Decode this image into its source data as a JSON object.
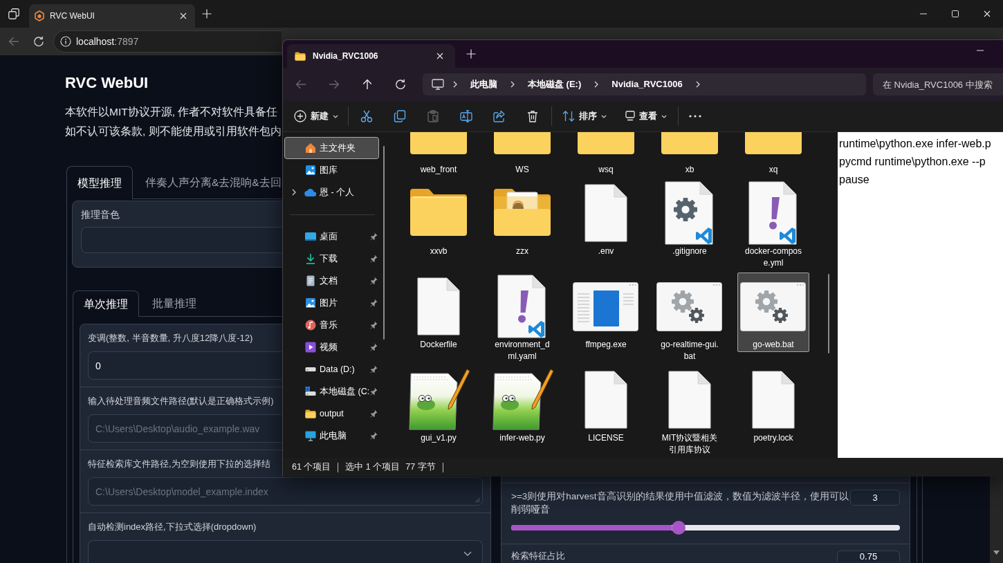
{
  "browser": {
    "tabs": [
      {
        "title": "RVC WebUI",
        "selected": true
      }
    ],
    "nav": [
      {
        "kind": "back",
        "disabled": true
      },
      {
        "kind": "reload",
        "disabled": false
      }
    ],
    "address": {
      "host": "localhost",
      "port": ":7897"
    }
  },
  "page": {
    "title": "RVC WebUI",
    "notice": [
      "本软件以MIT协议开源, 作者不对软件具备任",
      "如不认可该条款, 则不能使用或引用软件包内"
    ],
    "tabs": [
      {
        "label": "模型推理",
        "selected": true
      },
      {
        "label": "伴奏人声分离&去混响&去回",
        "selected": false
      }
    ],
    "voice": {
      "label": "推理音色"
    },
    "subtabs": [
      {
        "label": "单次推理",
        "selected": true
      },
      {
        "label": "批量推理",
        "selected": false
      }
    ],
    "left_fields": [
      {
        "kind": "textbox",
        "label": "变调(整数, 半音数量, 升八度12降八度-12)",
        "value": "0"
      },
      {
        "kind": "textbox",
        "label": "输入待处理音频文件路径(默认是正确格式示例)",
        "placeholder": "C:\\Users\\Desktop\\audio_example.wav"
      },
      {
        "kind": "textarea",
        "label": "特征检索库文件路径,为空则使用下拉的选择结",
        "placeholder": "C:\\Users\\Desktop\\model_example.index"
      },
      {
        "kind": "dropdown",
        "label": "自动检测index路径,下拉式选择(dropdown)"
      }
    ],
    "right_fields": [
      {
        "kind": "slider",
        "label": ">=3则使用对harvest音高识别的结果使用中值滤波，数值为滤波半径，使用可以削弱哑音",
        "value": "3",
        "level": 0.43
      },
      {
        "kind": "slider",
        "label": "检索特征占比",
        "value": "0.75"
      }
    ]
  },
  "explorer": {
    "tabs": [
      {
        "title": "Nvidia_RVC1006",
        "selected": true
      }
    ],
    "nav": [
      {
        "kind": "back",
        "disabled": true
      },
      {
        "kind": "forward",
        "disabled": true
      },
      {
        "kind": "up",
        "disabled": false
      },
      {
        "kind": "refresh",
        "disabled": false
      }
    ],
    "breadcrumb": [
      "此电脑",
      "本地磁盘 (E:)",
      "Nvidia_RVC1006"
    ],
    "search": {
      "placeholder": "在 Nvidia_RVC1006 中搜索"
    },
    "toolbar": [
      {
        "kind": "new",
        "label": "新建",
        "disabled": false
      },
      {
        "kind": "cut",
        "disabled": false
      },
      {
        "kind": "copy",
        "disabled": false
      },
      {
        "kind": "paste",
        "disabled": true
      },
      {
        "kind": "rename",
        "disabled": false
      },
      {
        "kind": "share",
        "disabled": false
      },
      {
        "kind": "delete",
        "disabled": false
      },
      {
        "kind": "sort",
        "label": "排序",
        "disabled": false
      },
      {
        "kind": "view",
        "label": "查看",
        "disabled": false
      },
      {
        "kind": "more",
        "disabled": false
      }
    ],
    "sidebar": [
      [
        {
          "kind": "home",
          "label": "主文件夹",
          "selected": true,
          "pinned": false
        },
        {
          "kind": "gallery",
          "label": "图库",
          "selected": false,
          "pinned": false
        },
        {
          "kind": "cloud",
          "label": "恩 - 个人",
          "selected": false,
          "pinned": false,
          "expanded": false
        }
      ],
      [
        {
          "kind": "desktop",
          "label": "桌面",
          "selected": false,
          "pinned": true
        },
        {
          "kind": "downloads",
          "label": "下载",
          "selected": false,
          "pinned": true
        },
        {
          "kind": "documents",
          "label": "文档",
          "selected": false,
          "pinned": true
        },
        {
          "kind": "pictures",
          "label": "图片",
          "selected": false,
          "pinned": true
        },
        {
          "kind": "music",
          "label": "音乐",
          "selected": false,
          "pinned": true
        },
        {
          "kind": "videos",
          "label": "视频",
          "selected": false,
          "pinned": true
        },
        {
          "kind": "drive",
          "label": "Data (D:)",
          "selected": false,
          "pinned": true
        },
        {
          "kind": "system_drive",
          "label": "本地磁盘 (C:",
          "selected": false,
          "pinned": true
        },
        {
          "kind": "folder",
          "label": "output",
          "selected": false,
          "pinned": true
        },
        {
          "kind": "this_pc",
          "label": "此电脑",
          "selected": false,
          "pinned": true
        }
      ]
    ],
    "files": [
      {
        "name": "web_front",
        "kind": "folder",
        "selected": false
      },
      {
        "name": "WS",
        "kind": "folder",
        "selected": false
      },
      {
        "name": "wsq",
        "kind": "folder",
        "selected": false
      },
      {
        "name": "xb",
        "kind": "folder",
        "selected": false
      },
      {
        "name": "xq",
        "kind": "folder",
        "selected": false
      },
      {
        "name": "xxvb",
        "kind": "folder",
        "selected": false
      },
      {
        "name": "zzx",
        "kind": "folder_with_content",
        "selected": false
      },
      {
        "name": ".env",
        "kind": "file",
        "selected": false
      },
      {
        "name": ".gitignore",
        "kind": "config",
        "selected": false
      },
      {
        "name": "docker-compose.yml",
        "kind": "yaml",
        "selected": false
      },
      {
        "name": "Dockerfile",
        "kind": "file",
        "selected": false
      },
      {
        "name": "environment_dml.yaml",
        "kind": "yaml",
        "selected": false
      },
      {
        "name": "ffmpeg.exe",
        "kind": "exe",
        "selected": false
      },
      {
        "name": "go-realtime-gui.bat",
        "kind": "bat",
        "selected": false
      },
      {
        "name": "go-web.bat",
        "kind": "bat",
        "selected": true
      },
      {
        "name": "gui_v1.py",
        "kind": "py",
        "selected": false
      },
      {
        "name": "infer-web.py",
        "kind": "py",
        "selected": false
      },
      {
        "name": "LICENSE",
        "kind": "file",
        "selected": false
      },
      {
        "name": "MIT协议暨相关引用库协议",
        "kind": "file",
        "selected": false
      },
      {
        "name": "poetry.lock",
        "kind": "file",
        "selected": false
      }
    ],
    "preview": {
      "lines": [
        "runtime\\python.exe infer-web.p",
        "pycmd runtime\\python.exe --p",
        "pause"
      ]
    },
    "status": {
      "count": "61 个项目",
      "selection": "选中 1 个项目",
      "size": "77 字节"
    }
  }
}
